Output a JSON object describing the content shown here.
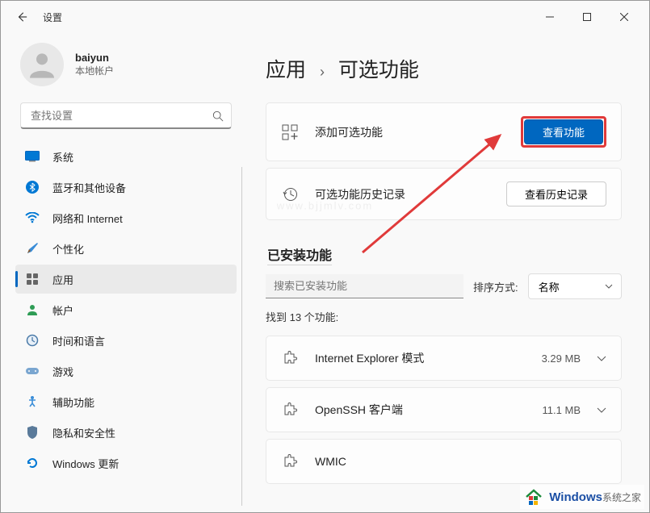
{
  "window": {
    "title": "设置"
  },
  "user": {
    "name": "baiyun",
    "account_type": "本地帐户"
  },
  "search": {
    "placeholder": "查找设置"
  },
  "nav": [
    {
      "id": "system",
      "label": "系统"
    },
    {
      "id": "bluetooth",
      "label": "蓝牙和其他设备"
    },
    {
      "id": "network",
      "label": "网络和 Internet"
    },
    {
      "id": "personalization",
      "label": "个性化"
    },
    {
      "id": "apps",
      "label": "应用"
    },
    {
      "id": "accounts",
      "label": "帐户"
    },
    {
      "id": "time",
      "label": "时间和语言"
    },
    {
      "id": "gaming",
      "label": "游戏"
    },
    {
      "id": "accessibility",
      "label": "辅助功能"
    },
    {
      "id": "privacy",
      "label": "隐私和安全性"
    },
    {
      "id": "update",
      "label": "Windows 更新"
    }
  ],
  "breadcrumb": {
    "parent": "应用",
    "current": "可选功能"
  },
  "cards": {
    "add": {
      "label": "添加可选功能",
      "button": "查看功能"
    },
    "history": {
      "label": "可选功能历史记录",
      "button": "查看历史记录"
    }
  },
  "installed": {
    "section_title": "已安装功能",
    "search_placeholder": "搜索已安装功能",
    "sort_label": "排序方式:",
    "sort_value": "名称",
    "count_text": "找到 13 个功能:"
  },
  "features": [
    {
      "name": "Internet Explorer 模式",
      "size": "3.29 MB"
    },
    {
      "name": "OpenSSH 客户端",
      "size": "11.1 MB"
    },
    {
      "name": "WMIC",
      "size": ""
    }
  ],
  "watermark": {
    "main": "Windows",
    "sub": "系统之家",
    "url": "www.bjjmlv.com"
  }
}
